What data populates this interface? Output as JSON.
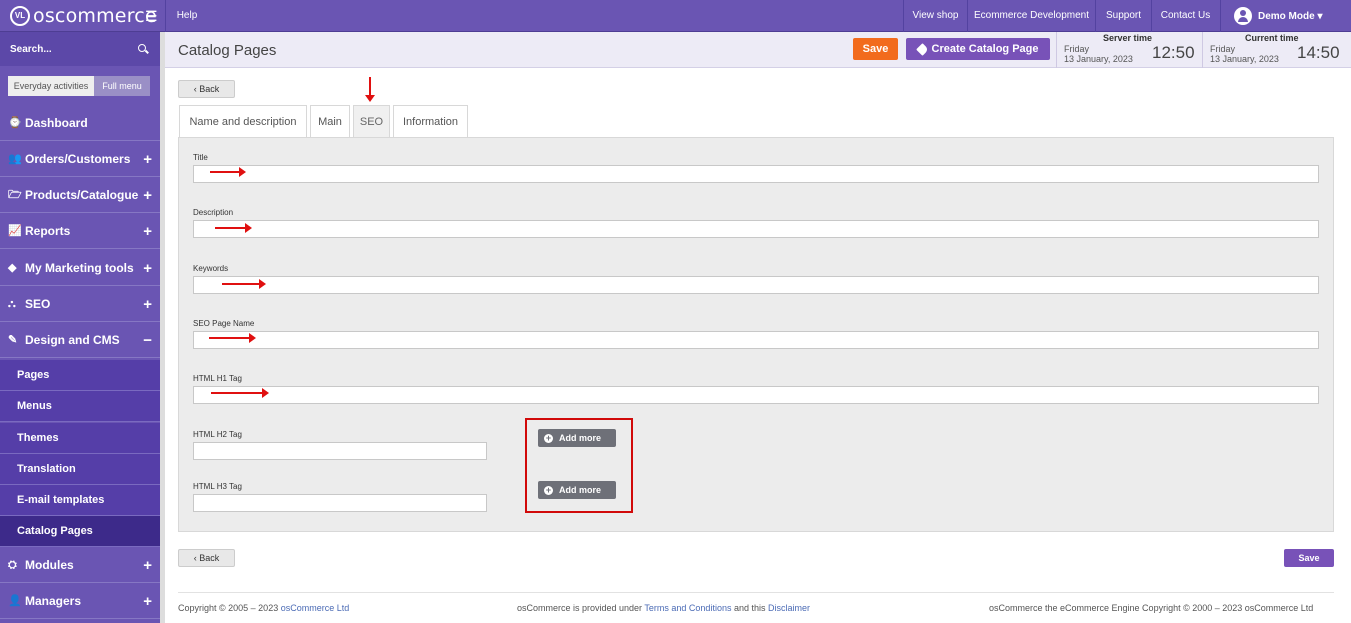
{
  "topbar": {
    "logo_text": "oscommerce",
    "logo_badge": "VL",
    "help": "Help",
    "links": [
      "View shop",
      "Ecommerce Development",
      "Support",
      "Contact Us"
    ],
    "user": "Demo Mode ▾"
  },
  "sidebar": {
    "search_placeholder": "Search...",
    "toggle_everyday": "Everyday activities",
    "toggle_full": "Full menu",
    "items": [
      {
        "label": "Dashboard",
        "icon": "dashboard-icon",
        "glyph": "⌚",
        "sign": ""
      },
      {
        "label": "Orders/Customers",
        "icon": "users-icon",
        "glyph": "👥",
        "sign": "+"
      },
      {
        "label": "Products/Catalogue",
        "icon": "folder-icon",
        "glyph": "🗁",
        "sign": "+"
      },
      {
        "label": "Reports",
        "icon": "chart-icon",
        "glyph": "📈",
        "sign": "+"
      },
      {
        "label": "My Marketing tools",
        "icon": "tag-icon",
        "glyph": "◆",
        "sign": "+"
      },
      {
        "label": "SEO",
        "icon": "sitemap-icon",
        "glyph": "⛬",
        "sign": "+"
      },
      {
        "label": "Design and CMS",
        "icon": "brush-icon",
        "glyph": "✎",
        "sign": "−"
      }
    ],
    "subitems": [
      "Pages",
      "Menus",
      "Themes",
      "Translation",
      "E-mail templates",
      "Catalog Pages"
    ],
    "items_after": [
      {
        "label": "Modules",
        "icon": "puzzle-icon",
        "glyph": "⛭",
        "sign": "+"
      },
      {
        "label": "Managers",
        "icon": "user-icon",
        "glyph": "👤",
        "sign": "+"
      }
    ]
  },
  "header": {
    "title": "Catalog Pages",
    "save": "Save",
    "create": "Create Catalog Page",
    "server_label": "Server time",
    "server_day": "Friday",
    "server_date": "13 January, 2023",
    "server_time": "12:50",
    "current_label": "Current time",
    "current_day": "Friday",
    "current_date": "13 January, 2023",
    "current_time": "14:50"
  },
  "back": "‹ Back",
  "tabs": [
    "Name and description",
    "Main",
    "SEO",
    "Information"
  ],
  "fields": {
    "title": "Title",
    "description": "Description",
    "keywords": "Keywords",
    "seo_page_name": "SEO Page Name",
    "h1": "HTML H1 Tag",
    "h2": "HTML H2 Tag",
    "h3": "HTML H3 Tag"
  },
  "add_more": "Add more",
  "save_bottom": "Save",
  "footer": {
    "left_pre": "Copyright © 2005 – 2023 ",
    "left_link": "osCommerce Ltd",
    "mid_pre": "osCommerce is provided under ",
    "mid_link1": "Terms and Conditions",
    "mid_and": " and this ",
    "mid_link2": "Disclaimer",
    "right": "osCommerce the eCommerce Engine Copyright © 2000 – 2023 osCommerce Ltd"
  },
  "colors": {
    "brand": "#6a55b3",
    "save_orange": "#f26b1d",
    "annotation_red": "#e01010"
  }
}
